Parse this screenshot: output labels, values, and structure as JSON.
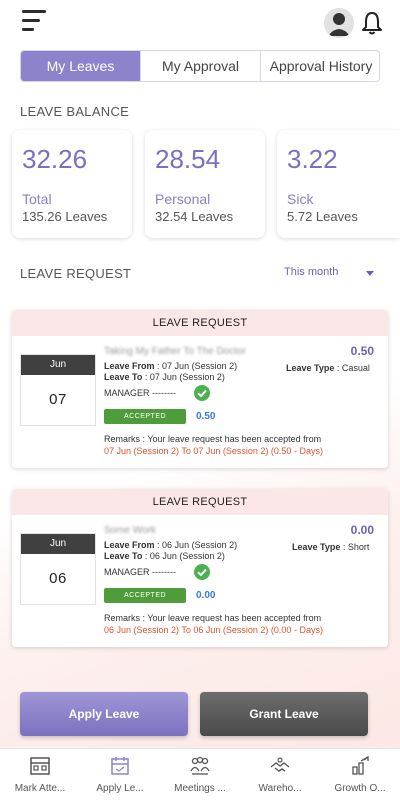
{
  "header": {
    "menu_icon": "hamburger-icon",
    "avatar_icon": "user-avatar-icon",
    "bell_icon": "bell-icon"
  },
  "tabs": [
    {
      "label": "My Leaves",
      "active": true
    },
    {
      "label": "My Approval",
      "active": false
    },
    {
      "label": "Approval History",
      "active": false
    }
  ],
  "balance": {
    "section_label": "LEAVE BALANCE",
    "cards": [
      {
        "value": "32.26",
        "name": "Total",
        "sub": "135.26 Leaves"
      },
      {
        "value": "28.54",
        "name": "Personal",
        "sub": "32.54 Leaves"
      },
      {
        "value": "3.22",
        "name": "Sick",
        "sub": "5.72 Leaves"
      }
    ]
  },
  "requests_section": {
    "label": "LEAVE REQUEST",
    "filter": "This month"
  },
  "requests": [
    {
      "header": "LEAVE REQUEST",
      "month": "Jun",
      "day": "07",
      "title": "Taking My Father To The Doctor",
      "days": "0.50",
      "from_label": "Leave From",
      "from_value": ": 07 Jun (Session 2)",
      "to_label": "Leave To",
      "to_value": ": 07 Jun (Session 2)",
      "type_label": "Leave Type",
      "type_value": ": Casual",
      "manager": "MANAGER --------",
      "status": "ACCEPTED",
      "accepted_days": "0.50",
      "remark_line1": "Remarks : Your leave request has been accepted from",
      "remark_line2": "07 Jun (Session 2) To 07 Jun (Session 2) (0.50 - Days)"
    },
    {
      "header": "LEAVE REQUEST",
      "month": "Jun",
      "day": "06",
      "title": "Some Work",
      "days": "0.00",
      "from_label": "Leave From",
      "from_value": ": 06 Jun (Session 2)",
      "to_label": "Leave To",
      "to_value": ": 06 Jun (Session 2)",
      "type_label": "Leave Type",
      "type_value": ": Short",
      "manager": "MANAGER --------",
      "status": "ACCEPTED",
      "accepted_days": "0.00",
      "remark_line1": "Remarks : Your leave request has been accepted from",
      "remark_line2": "06 Jun (Session 2) To 06 Jun (Session 2) (0.00 - Days)"
    }
  ],
  "actions": {
    "apply": "Apply Leave",
    "grant": "Grant Leave"
  },
  "bottom_nav": [
    {
      "label": "Mark Atte...",
      "icon": "attendance-icon"
    },
    {
      "label": "Apply Le...",
      "icon": "apply-leave-icon"
    },
    {
      "label": "Meetings ...",
      "icon": "meetings-icon"
    },
    {
      "label": "Wareho...",
      "icon": "warehouse-icon"
    },
    {
      "label": "Growth O...",
      "icon": "growth-icon"
    }
  ],
  "colors": {
    "accent": "#8c83cc",
    "accepted": "#4f9d3a",
    "remark_highlight": "#d9542f",
    "request_header": "#fbe7e7"
  }
}
